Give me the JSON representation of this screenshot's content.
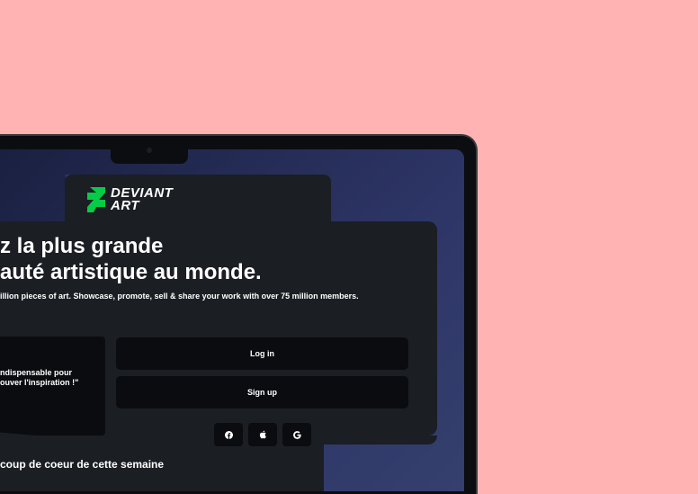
{
  "brand": {
    "logo_line1": "DEVIANT",
    "logo_line2": "ART",
    "logo_color": "#05CC47"
  },
  "hero": {
    "headline_line1": "z la plus grande",
    "headline_line2": "auté artistique au monde.",
    "subline": "illion pieces of art. Showcase, promote, sell & share your work with over 75 million members."
  },
  "quote": {
    "line1": "ndispensable pour",
    "line2": "ouver l'inspiration !\""
  },
  "auth": {
    "login_label": "Log in",
    "signup_label": "Sign up",
    "social": [
      "facebook-icon",
      "apple-icon",
      "google-icon"
    ]
  },
  "section": {
    "title": "coup de coeur de cette semaine"
  },
  "colors": {
    "background": "#FFB3B3",
    "panel": "#1B1E23",
    "button": "#0B0C10",
    "screen_accent": "#2D3566"
  }
}
